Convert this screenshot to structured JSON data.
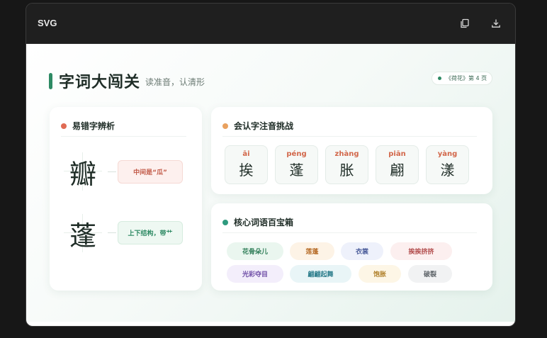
{
  "window": {
    "title": "SVG",
    "icons": [
      "copy-icon",
      "download-icon"
    ]
  },
  "page": {
    "title": "字词大闯关",
    "subtitle": "读准音，认清形",
    "lesson": "《荷花》第 4 页"
  },
  "colors": {
    "accent": "#2e8a64",
    "red": "#e06b54",
    "orange": "#e9a15f",
    "teal": "#2e9a7e"
  },
  "cards": {
    "confusing": {
      "title": "易错字辨析",
      "items": [
        {
          "char": "瓣",
          "note": "中间是“瓜”"
        },
        {
          "char": "蓬",
          "note": "上下结构，带艹"
        }
      ]
    },
    "pinyin": {
      "title": "会认字注音挑战",
      "items": [
        {
          "pinyin": "āi",
          "char": "挨"
        },
        {
          "pinyin": "péng",
          "char": "蓬"
        },
        {
          "pinyin": "zhàng",
          "char": "胀"
        },
        {
          "pinyin": "piān",
          "char": "翩"
        },
        {
          "pinyin": "yàng",
          "char": "漾"
        }
      ]
    },
    "words": {
      "title": "核心词语百宝箱",
      "row1": [
        "花骨朵儿",
        "莲蓬",
        "衣裳",
        "挨挨挤挤"
      ],
      "row2": [
        "光彩夺目",
        "翩翩起舞",
        "饱胀",
        "破裂"
      ]
    }
  }
}
